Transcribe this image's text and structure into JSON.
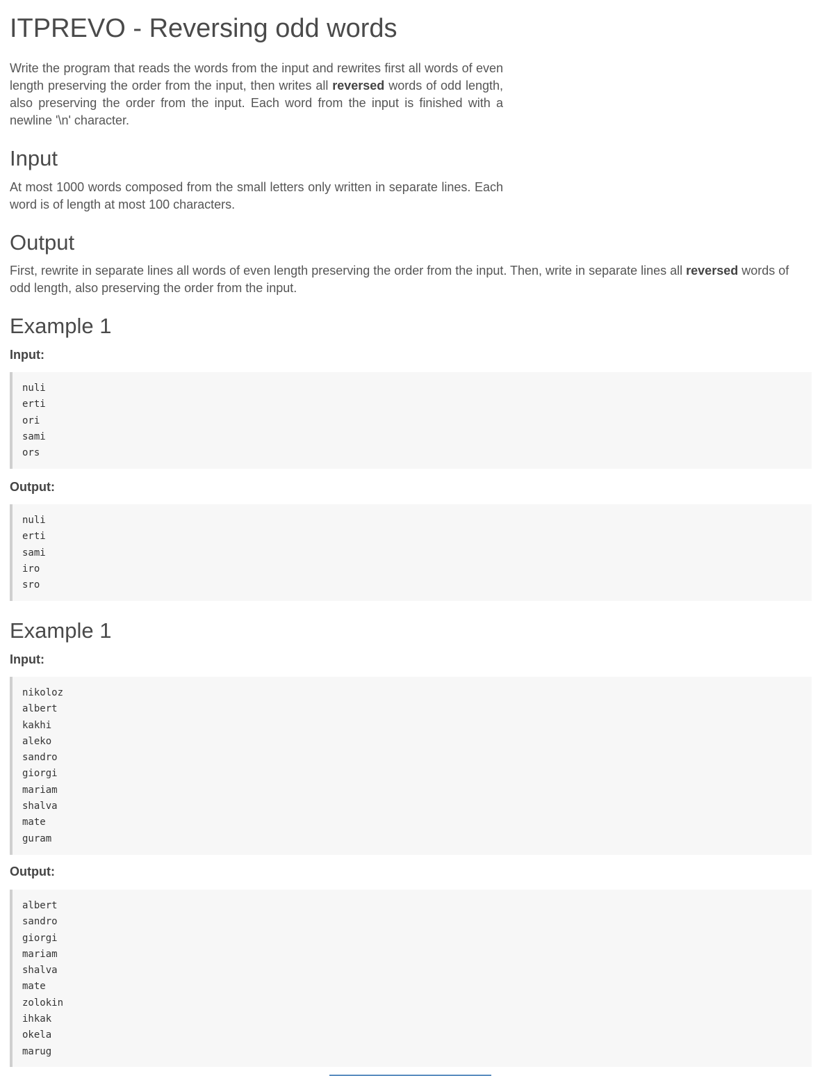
{
  "title": "ITPREVO - Reversing odd words",
  "description": {
    "part1": "Write the program that reads the words from the input and rewrites first all words of even length preserving the order from the input, then writes all ",
    "bold": "reversed",
    "part2": " words of odd length, also preserving the order from the input. Each word from the input is finished with a newline '\\n' character."
  },
  "input_section": {
    "heading": "Input",
    "text": "At most 1000 words composed from the small letters only written in separate lines. Each word is of length at most 100 characters."
  },
  "output_section": {
    "heading": "Output",
    "part1": "First, rewrite in separate lines all words of even length preserving the order from the input. Then, write in separate lines all ",
    "bold": "reversed",
    "part2": " words of odd length, also preserving the order from the input."
  },
  "examples": [
    {
      "heading": "Example 1",
      "input_label": "Input:",
      "input_lines": [
        "nuli",
        "erti",
        "ori",
        "sami",
        "ors"
      ],
      "output_label": "Output:",
      "output_lines": [
        "nuli",
        "erti",
        "sami",
        "iro",
        "sro"
      ]
    },
    {
      "heading": "Example 1",
      "input_label": "Input:",
      "input_lines": [
        "nikoloz",
        "albert",
        "kakhi",
        "aleko",
        "sandro",
        "giorgi",
        "mariam",
        "shalva",
        "mate",
        "guram"
      ],
      "output_label": "Output:",
      "output_lines": [
        "albert",
        "sandro",
        "giorgi",
        "mariam",
        "shalva",
        "mate",
        "zolokin",
        "ihkak",
        "okela",
        "marug"
      ]
    }
  ]
}
